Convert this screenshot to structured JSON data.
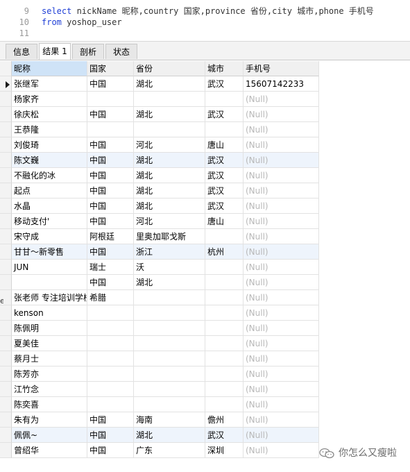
{
  "editor": {
    "lines": [
      {
        "num": "9",
        "keyword": "select",
        "text": " nickName 昵称,country 国家,province 省份,city 城市,phone 手机号"
      },
      {
        "num": "10",
        "keyword": "from",
        "text": " yoshop_user"
      },
      {
        "num": "11",
        "keyword": "",
        "text": ""
      }
    ]
  },
  "tabs": [
    "信息",
    "结果 1",
    "剖析",
    "状态"
  ],
  "active_tab": 1,
  "columns": [
    "昵称",
    "国家",
    "省份",
    "城市",
    "手机号"
  ],
  "null_text": "(Null)",
  "rows": [
    [
      "张继军",
      "中国",
      "湖北",
      "武汉",
      "15607142233"
    ],
    [
      "杨家齐",
      "",
      "",
      "",
      null
    ],
    [
      "徐庆松",
      "中国",
      "湖北",
      "武汉",
      null
    ],
    [
      "王恭隆",
      "",
      "",
      "",
      null
    ],
    [
      "刘俊琦",
      "中国",
      "河北",
      "唐山",
      null
    ],
    [
      "陈文巍",
      "中国",
      "湖北",
      "武汉",
      null
    ],
    [
      "不融化的冰",
      "中国",
      "湖北",
      "武汉",
      null
    ],
    [
      "起点",
      "中国",
      "湖北",
      "武汉",
      null
    ],
    [
      "水晶",
      "中国",
      "湖北",
      "武汉",
      null
    ],
    [
      "移动支付'",
      "中国",
      "河北",
      "唐山",
      null
    ],
    [
      "宋守成",
      "阿根廷",
      "里奥加耶戈斯",
      "",
      null
    ],
    [
      "甘甘～新零售",
      "中国",
      "浙江",
      "杭州",
      null
    ],
    [
      "JUN",
      "瑞士",
      "沃",
      "",
      null
    ],
    [
      "",
      "中国",
      "湖北",
      "",
      null
    ],
    [
      "张老师 专注培训学校",
      "希腊",
      "",
      "",
      null
    ],
    [
      "kenson",
      "",
      "",
      "",
      null
    ],
    [
      "陈佩明",
      "",
      "",
      "",
      null
    ],
    [
      "夏美佳",
      "",
      "",
      "",
      null
    ],
    [
      "蔡月士",
      "",
      "",
      "",
      null
    ],
    [
      "陈芳亦",
      "",
      "",
      "",
      null
    ],
    [
      "江竹念",
      "",
      "",
      "",
      null
    ],
    [
      "陈奕喜",
      "",
      "",
      "",
      null
    ],
    [
      "朱有为",
      "中国",
      "海南",
      "儋州",
      null
    ],
    [
      "佩佩~",
      "中国",
      "湖北",
      "武汉",
      null
    ],
    [
      "曾绍华",
      "中国",
      "广东",
      "深圳",
      null
    ]
  ],
  "highlight_rows": [
    5,
    11,
    23
  ],
  "stray_text": "e",
  "watermark": {
    "text": "你怎么又瘦啦",
    "icon": "wechat-icon"
  }
}
